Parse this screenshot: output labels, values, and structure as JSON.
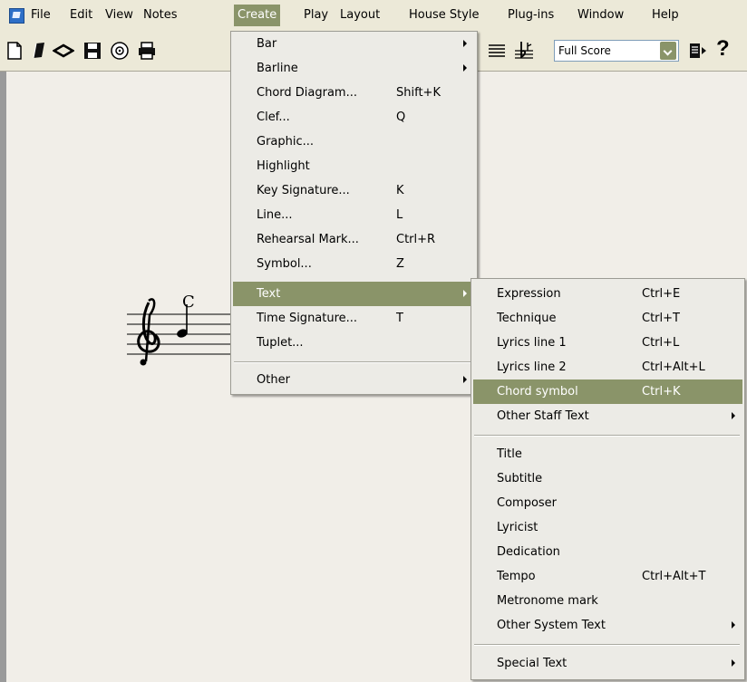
{
  "menubar": {
    "items": [
      {
        "label": "File"
      },
      {
        "label": "Edit"
      },
      {
        "label": "View"
      },
      {
        "label": "Notes"
      },
      {
        "label": "Create"
      },
      {
        "label": "Play"
      },
      {
        "label": "Layout"
      },
      {
        "label": "House Style"
      },
      {
        "label": "Plug-ins"
      },
      {
        "label": "Window"
      },
      {
        "label": "Help"
      }
    ]
  },
  "toolbar": {
    "view_select": "Full Score",
    "help_glyph": "?"
  },
  "score": {
    "chord_symbol": "C"
  },
  "create_menu": {
    "items": [
      {
        "label": "Bar",
        "shortcut": ""
      },
      {
        "label": "Barline",
        "shortcut": ""
      },
      {
        "label": "Chord Diagram...",
        "shortcut": "Shift+K"
      },
      {
        "label": "Clef...",
        "shortcut": "Q"
      },
      {
        "label": "Graphic...",
        "shortcut": ""
      },
      {
        "label": "Highlight",
        "shortcut": ""
      },
      {
        "label": "Key Signature...",
        "shortcut": "K"
      },
      {
        "label": "Line...",
        "shortcut": "L"
      },
      {
        "label": "Rehearsal Mark...",
        "shortcut": "Ctrl+R"
      },
      {
        "label": "Symbol...",
        "shortcut": "Z"
      },
      {
        "label": "Text",
        "shortcut": ""
      },
      {
        "label": "Time Signature...",
        "shortcut": "T"
      },
      {
        "label": "Tuplet...",
        "shortcut": ""
      },
      {
        "label": "Other",
        "shortcut": ""
      }
    ]
  },
  "text_submenu": {
    "items": [
      {
        "label": "Expression",
        "shortcut": "Ctrl+E"
      },
      {
        "label": "Technique",
        "shortcut": "Ctrl+T"
      },
      {
        "label": "Lyrics line 1",
        "shortcut": "Ctrl+L"
      },
      {
        "label": "Lyrics line 2",
        "shortcut": "Ctrl+Alt+L"
      },
      {
        "label": "Chord symbol",
        "shortcut": "Ctrl+K"
      },
      {
        "label": "Other Staff Text",
        "shortcut": ""
      },
      {
        "label": "Title",
        "shortcut": ""
      },
      {
        "label": "Subtitle",
        "shortcut": ""
      },
      {
        "label": "Composer",
        "shortcut": ""
      },
      {
        "label": "Lyricist",
        "shortcut": ""
      },
      {
        "label": "Dedication",
        "shortcut": ""
      },
      {
        "label": "Tempo",
        "shortcut": "Ctrl+Alt+T"
      },
      {
        "label": "Metronome mark",
        "shortcut": ""
      },
      {
        "label": "Other System Text",
        "shortcut": ""
      },
      {
        "label": "Special Text",
        "shortcut": ""
      }
    ]
  },
  "colors": {
    "highlight": "#8a9469",
    "menu_bg": "#ecebe6",
    "paper": "#f1eee8"
  }
}
